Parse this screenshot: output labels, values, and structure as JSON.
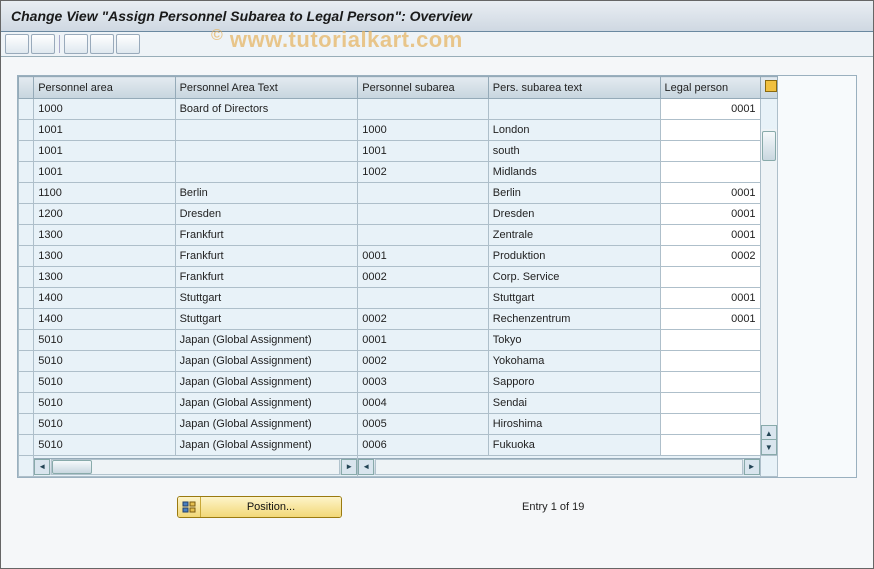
{
  "title": "Change View \"Assign Personnel Subarea to Legal Person\": Overview",
  "watermark": "www.tutorialkart.com",
  "columns": {
    "c0": "Personnel area",
    "c1": "Personnel Area Text",
    "c2": "Personnel subarea",
    "c3": "Pers. subarea text",
    "c4": "Legal person"
  },
  "rows": [
    {
      "pa": "1000",
      "pat": "Board of Directors",
      "ps": "",
      "pst": "",
      "lp": "0001"
    },
    {
      "pa": "1001",
      "pat": "",
      "ps": "1000",
      "pst": "London",
      "lp": ""
    },
    {
      "pa": "1001",
      "pat": "",
      "ps": "1001",
      "pst": "south",
      "lp": ""
    },
    {
      "pa": "1001",
      "pat": "",
      "ps": "1002",
      "pst": "Midlands",
      "lp": ""
    },
    {
      "pa": "1100",
      "pat": "Berlin",
      "ps": "",
      "pst": "Berlin",
      "lp": "0001"
    },
    {
      "pa": "1200",
      "pat": "Dresden",
      "ps": "",
      "pst": "Dresden",
      "lp": "0001"
    },
    {
      "pa": "1300",
      "pat": "Frankfurt",
      "ps": "",
      "pst": "Zentrale",
      "lp": "0001"
    },
    {
      "pa": "1300",
      "pat": "Frankfurt",
      "ps": "0001",
      "pst": "Produktion",
      "lp": "0002"
    },
    {
      "pa": "1300",
      "pat": "Frankfurt",
      "ps": "0002",
      "pst": "Corp. Service",
      "lp": ""
    },
    {
      "pa": "1400",
      "pat": "Stuttgart",
      "ps": "",
      "pst": "Stuttgart",
      "lp": "0001"
    },
    {
      "pa": "1400",
      "pat": "Stuttgart",
      "ps": "0002",
      "pst": "Rechenzentrum",
      "lp": "0001"
    },
    {
      "pa": "5010",
      "pat": "Japan (Global Assignment)",
      "ps": "0001",
      "pst": "Tokyo",
      "lp": ""
    },
    {
      "pa": "5010",
      "pat": "Japan (Global Assignment)",
      "ps": "0002",
      "pst": "Yokohama",
      "lp": ""
    },
    {
      "pa": "5010",
      "pat": "Japan (Global Assignment)",
      "ps": "0003",
      "pst": "Sapporo",
      "lp": ""
    },
    {
      "pa": "5010",
      "pat": "Japan (Global Assignment)",
      "ps": "0004",
      "pst": "Sendai",
      "lp": ""
    },
    {
      "pa": "5010",
      "pat": "Japan (Global Assignment)",
      "ps": "0005",
      "pst": "Hiroshima",
      "lp": ""
    },
    {
      "pa": "5010",
      "pat": "Japan (Global Assignment)",
      "ps": "0006",
      "pst": "Fukuoka",
      "lp": ""
    }
  ],
  "footer": {
    "position_label": "Position...",
    "entry_text": "Entry 1 of 19"
  }
}
